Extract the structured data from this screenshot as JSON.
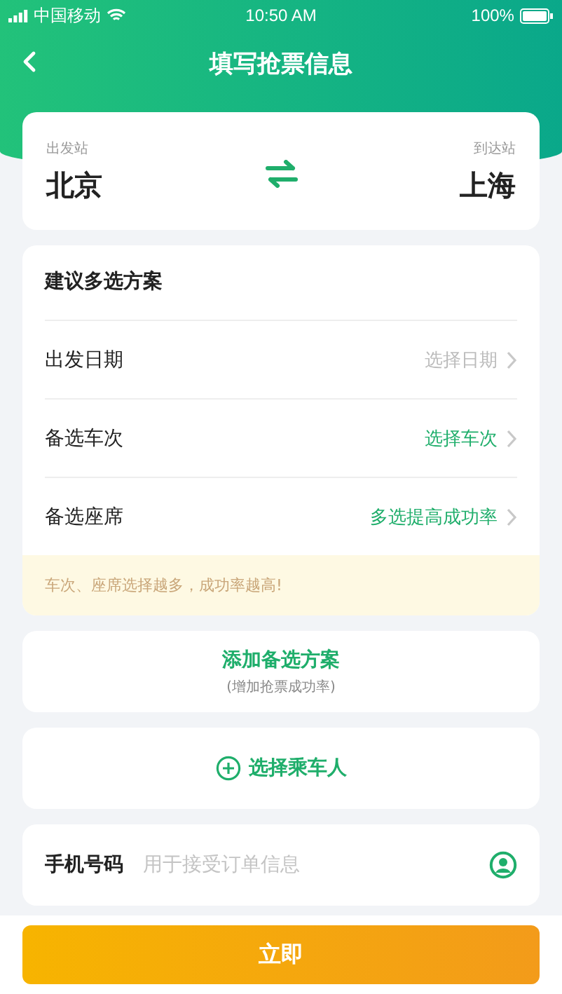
{
  "status_bar": {
    "carrier": "中国移动",
    "time": "10:50 AM",
    "battery": "100%"
  },
  "header": {
    "title": "填写抢票信息"
  },
  "route": {
    "from_label": "出发站",
    "from": "北京",
    "to_label": "到达站",
    "to": "上海"
  },
  "plan": {
    "title": "建议多选方案",
    "rows": [
      {
        "label": "出发日期",
        "value": "选择日期",
        "kind": "placeholder"
      },
      {
        "label": "备选车次",
        "value": "选择车次",
        "kind": "value"
      },
      {
        "label": "备选座席",
        "value": "多选提高成功率",
        "kind": "value"
      }
    ],
    "tip": "车次、座席选择越多，成功率越高!"
  },
  "add_plan": {
    "title": "添加备选方案",
    "subtitle": "(增加抢票成功率)"
  },
  "passenger": {
    "label": "选择乘车人"
  },
  "phone": {
    "label": "手机号码",
    "placeholder": "用于接受订单信息"
  },
  "submit": {
    "label": "立即"
  }
}
